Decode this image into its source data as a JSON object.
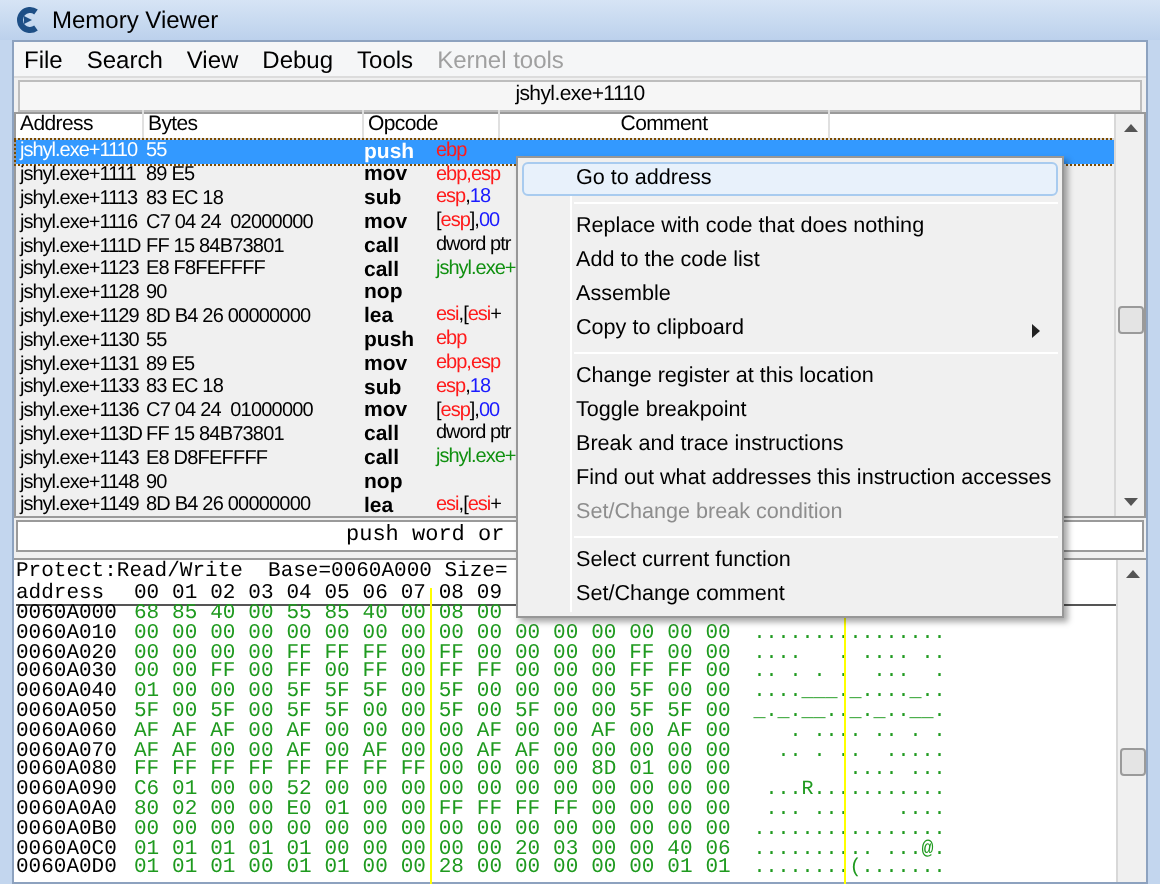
{
  "window": {
    "title": "Memory Viewer"
  },
  "menu": [
    {
      "label": "File",
      "disabled": false
    },
    {
      "label": "Search",
      "disabled": false
    },
    {
      "label": "View",
      "disabled": false
    },
    {
      "label": "Debug",
      "disabled": false
    },
    {
      "label": "Tools",
      "disabled": false
    },
    {
      "label": "Kernel tools",
      "disabled": true
    }
  ],
  "address_bar": {
    "value": "jshyl.exe+1110"
  },
  "disassembly": {
    "columns": [
      "Address",
      "Bytes",
      "Opcode",
      "Comment"
    ],
    "rows": [
      {
        "address": "jshyl.exe+1110",
        "bytes": "55",
        "opcode": "push",
        "params": [
          {
            "text": "ebp",
            "kind": "reg"
          }
        ],
        "selected": true
      },
      {
        "address": "jshyl.exe+1111",
        "bytes": "89 E5",
        "opcode": "mov",
        "params": [
          {
            "text": "ebp,esp",
            "kind": "reg"
          }
        ],
        "selected": false
      },
      {
        "address": "jshyl.exe+1113",
        "bytes": "83 EC 18",
        "opcode": "sub",
        "params": [
          {
            "text": "esp",
            "kind": "reg"
          },
          {
            "text": ",",
            "kind": "sym"
          },
          {
            "text": "18",
            "kind": "num"
          }
        ],
        "selected": false
      },
      {
        "address": "jshyl.exe+1116",
        "bytes": "C7 04 24  02000000",
        "opcode": "mov",
        "params": [
          {
            "text": "[",
            "kind": "sym"
          },
          {
            "text": "esp",
            "kind": "reg"
          },
          {
            "text": "],",
            "kind": "sym"
          },
          {
            "text": "00",
            "kind": "num"
          }
        ],
        "selected": false
      },
      {
        "address": "jshyl.exe+111D",
        "bytes": "FF 15 84B73801",
        "opcode": "call",
        "params": [
          {
            "text": "dword ptr",
            "kind": "sym"
          }
        ],
        "selected": false
      },
      {
        "address": "jshyl.exe+1123",
        "bytes": "E8 F8FEFFFF",
        "opcode": "call",
        "params": [
          {
            "text": "jshyl.exe+",
            "kind": "addr"
          }
        ],
        "selected": false
      },
      {
        "address": "jshyl.exe+1128",
        "bytes": "90",
        "opcode": "nop",
        "params": [],
        "selected": false
      },
      {
        "address": "jshyl.exe+1129",
        "bytes": "8D B4 26 00000000",
        "opcode": "lea",
        "params": [
          {
            "text": "esi",
            "kind": "reg"
          },
          {
            "text": ",[",
            "kind": "sym"
          },
          {
            "text": "esi",
            "kind": "reg"
          },
          {
            "text": "+",
            "kind": "sym"
          }
        ],
        "selected": false
      },
      {
        "address": "jshyl.exe+1130",
        "bytes": "55",
        "opcode": "push",
        "params": [
          {
            "text": "ebp",
            "kind": "reg"
          }
        ],
        "selected": false
      },
      {
        "address": "jshyl.exe+1131",
        "bytes": "89 E5",
        "opcode": "mov",
        "params": [
          {
            "text": "ebp,esp",
            "kind": "reg"
          }
        ],
        "selected": false
      },
      {
        "address": "jshyl.exe+1133",
        "bytes": "83 EC 18",
        "opcode": "sub",
        "params": [
          {
            "text": "esp",
            "kind": "reg"
          },
          {
            "text": ",",
            "kind": "sym"
          },
          {
            "text": "18",
            "kind": "num"
          }
        ],
        "selected": false
      },
      {
        "address": "jshyl.exe+1136",
        "bytes": "C7 04 24  01000000",
        "opcode": "mov",
        "params": [
          {
            "text": "[",
            "kind": "sym"
          },
          {
            "text": "esp",
            "kind": "reg"
          },
          {
            "text": "],",
            "kind": "sym"
          },
          {
            "text": "00",
            "kind": "num"
          }
        ],
        "selected": false
      },
      {
        "address": "jshyl.exe+113D",
        "bytes": "FF 15 84B73801",
        "opcode": "call",
        "params": [
          {
            "text": "dword ptr",
            "kind": "sym"
          }
        ],
        "selected": false
      },
      {
        "address": "jshyl.exe+1143",
        "bytes": "E8 D8FEFFFF",
        "opcode": "call",
        "params": [
          {
            "text": "jshyl.exe+",
            "kind": "addr"
          }
        ],
        "selected": false
      },
      {
        "address": "jshyl.exe+1148",
        "bytes": "90",
        "opcode": "nop",
        "params": [],
        "selected": false
      },
      {
        "address": "jshyl.exe+1149",
        "bytes": "8D B4 26 00000000",
        "opcode": "lea",
        "params": [
          {
            "text": "esi",
            "kind": "reg"
          },
          {
            "text": ",[",
            "kind": "sym"
          },
          {
            "text": "esi",
            "kind": "reg"
          },
          {
            "text": "+",
            "kind": "sym"
          }
        ],
        "selected": false
      }
    ]
  },
  "instruction_field": {
    "value": "push word or"
  },
  "hex_view": {
    "info": "Protect:Read/Write  Base=0060A000 Size=",
    "header": {
      "label": "address",
      "columns": [
        "00",
        "01",
        "02",
        "03",
        "04",
        "05",
        "06",
        "07",
        "08",
        "09"
      ]
    },
    "rows": [
      {
        "address": "0060A000",
        "bytes": [
          "68",
          "85",
          "40",
          "00",
          "55",
          "85",
          "40",
          "00",
          "08",
          "00"
        ]
      },
      {
        "address": "0060A010",
        "bytes": [
          "00",
          "00",
          "00",
          "00",
          "00",
          "00",
          "00",
          "00",
          "00",
          "00",
          "00",
          "00",
          "00",
          "00",
          "00",
          "00"
        ],
        "ascii": "................"
      },
      {
        "address": "0060A020",
        "bytes": [
          "00",
          "00",
          "00",
          "00",
          "FF",
          "FF",
          "FF",
          "00",
          "FF",
          "00",
          "00",
          "00",
          "00",
          "FF",
          "00",
          "00"
        ],
        "ascii": "....   . .... .."
      },
      {
        "address": "0060A030",
        "bytes": [
          "00",
          "00",
          "FF",
          "00",
          "FF",
          "00",
          "FF",
          "00",
          "FF",
          "FF",
          "00",
          "00",
          "00",
          "FF",
          "FF",
          "00"
        ],
        "ascii": ".. . . .  ...  ."
      },
      {
        "address": "0060A040",
        "bytes": [
          "01",
          "00",
          "00",
          "00",
          "5F",
          "5F",
          "5F",
          "00",
          "5F",
          "00",
          "00",
          "00",
          "00",
          "5F",
          "00",
          "00"
        ],
        "ascii": "....___._...._.."
      },
      {
        "address": "0060A050",
        "bytes": [
          "5F",
          "00",
          "5F",
          "00",
          "5F",
          "5F",
          "00",
          "00",
          "5F",
          "00",
          "5F",
          "00",
          "00",
          "5F",
          "5F",
          "00"
        ],
        "ascii": "_._.__.._._..__."
      },
      {
        "address": "0060A060",
        "bytes": [
          "AF",
          "AF",
          "AF",
          "00",
          "AF",
          "00",
          "00",
          "00",
          "00",
          "AF",
          "00",
          "00",
          "AF",
          "00",
          "AF",
          "00"
        ],
        "ascii": "   . .... .. . ."
      },
      {
        "address": "0060A070",
        "bytes": [
          "AF",
          "AF",
          "00",
          "00",
          "AF",
          "00",
          "AF",
          "00",
          "00",
          "AF",
          "AF",
          "00",
          "00",
          "00",
          "00",
          "00"
        ],
        "ascii": "  .. . ..  ....."
      },
      {
        "address": "0060A080",
        "bytes": [
          "FF",
          "FF",
          "FF",
          "FF",
          "FF",
          "FF",
          "FF",
          "FF",
          "00",
          "00",
          "00",
          "00",
          "8D",
          "01",
          "00",
          "00"
        ],
        "ascii": "        .... ..."
      },
      {
        "address": "0060A090",
        "bytes": [
          "C6",
          "01",
          "00",
          "00",
          "52",
          "00",
          "00",
          "00",
          "00",
          "00",
          "00",
          "00",
          "00",
          "00",
          "00",
          "00"
        ],
        "ascii": " ...R..........."
      },
      {
        "address": "0060A0A0",
        "bytes": [
          "80",
          "02",
          "00",
          "00",
          "E0",
          "01",
          "00",
          "00",
          "FF",
          "FF",
          "FF",
          "FF",
          "00",
          "00",
          "00",
          "00"
        ],
        "ascii": " ... ...    ...."
      },
      {
        "address": "0060A0B0",
        "bytes": [
          "00",
          "00",
          "00",
          "00",
          "00",
          "00",
          "00",
          "00",
          "00",
          "00",
          "00",
          "00",
          "00",
          "00",
          "00",
          "00"
        ],
        "ascii": "................"
      },
      {
        "address": "0060A0C0",
        "bytes": [
          "01",
          "01",
          "01",
          "01",
          "01",
          "00",
          "00",
          "00",
          "00",
          "00",
          "20",
          "03",
          "00",
          "00",
          "40",
          "06"
        ],
        "ascii": ".......... ...@."
      },
      {
        "address": "0060A0D0",
        "bytes": [
          "01",
          "01",
          "01",
          "00",
          "01",
          "01",
          "00",
          "00",
          "28",
          "00",
          "00",
          "00",
          "00",
          "00",
          "01",
          "01"
        ],
        "ascii": "........(......."
      }
    ]
  },
  "context_menu": {
    "items": [
      {
        "kind": "item",
        "label": "Go to address",
        "highlighted": true,
        "disabled": false,
        "submenu": false
      },
      {
        "kind": "separator"
      },
      {
        "kind": "item",
        "label": "Replace with code that does nothing",
        "highlighted": false,
        "disabled": false,
        "submenu": false
      },
      {
        "kind": "item",
        "label": "Add to the code list",
        "highlighted": false,
        "disabled": false,
        "submenu": false
      },
      {
        "kind": "item",
        "label": "Assemble",
        "highlighted": false,
        "disabled": false,
        "submenu": false
      },
      {
        "kind": "item",
        "label": "Copy to clipboard",
        "highlighted": false,
        "disabled": false,
        "submenu": true
      },
      {
        "kind": "separator"
      },
      {
        "kind": "item",
        "label": "Change register at this location",
        "highlighted": false,
        "disabled": false,
        "submenu": false
      },
      {
        "kind": "item",
        "label": "Toggle breakpoint",
        "highlighted": false,
        "disabled": false,
        "submenu": false
      },
      {
        "kind": "item",
        "label": "Break and trace instructions",
        "highlighted": false,
        "disabled": false,
        "submenu": false
      },
      {
        "kind": "item",
        "label": "Find out what addresses this instruction accesses",
        "highlighted": false,
        "disabled": false,
        "submenu": false
      },
      {
        "kind": "item",
        "label": "Set/Change break condition",
        "highlighted": false,
        "disabled": true,
        "submenu": false
      },
      {
        "kind": "separator"
      },
      {
        "kind": "item",
        "label": "Select current function",
        "highlighted": false,
        "disabled": false,
        "submenu": false
      },
      {
        "kind": "item",
        "label": "Set/Change comment",
        "highlighted": false,
        "disabled": false,
        "submenu": false
      }
    ]
  }
}
